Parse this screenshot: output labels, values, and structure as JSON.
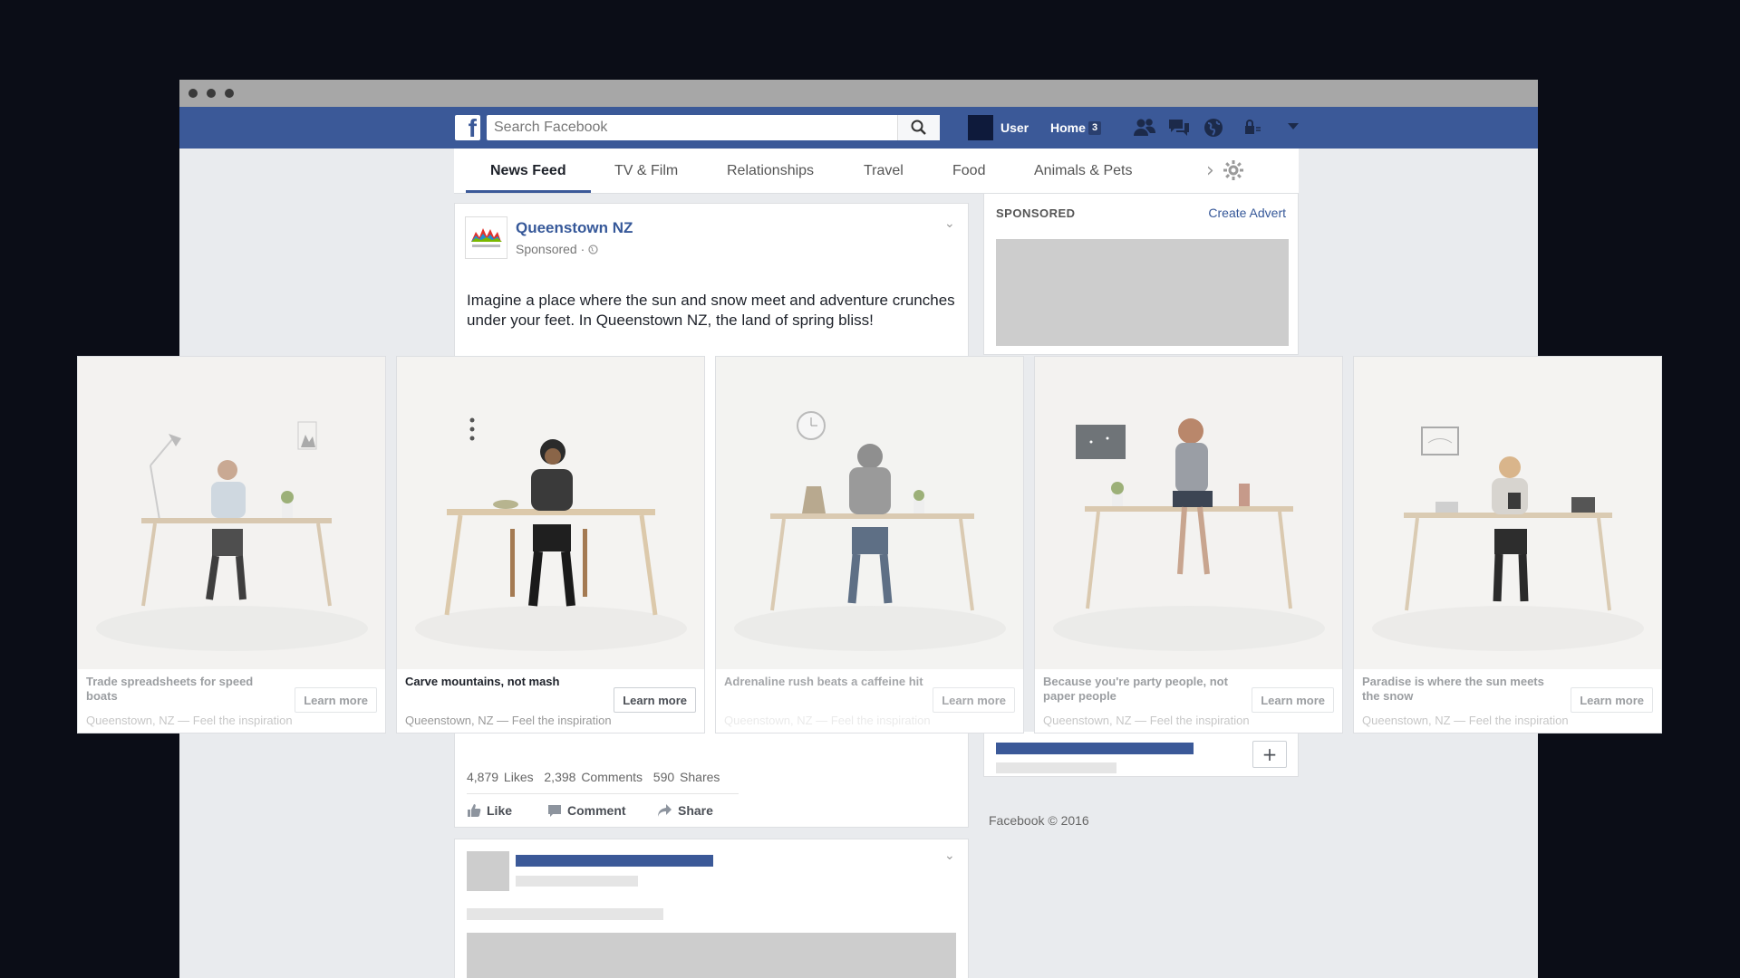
{
  "header": {
    "search_placeholder": "Search Facebook",
    "user_label": "User",
    "home_label": "Home",
    "home_badge": "3"
  },
  "tabs": [
    {
      "label": "News Feed",
      "active": true
    },
    {
      "label": "TV & Film"
    },
    {
      "label": "Relationships"
    },
    {
      "label": "Travel"
    },
    {
      "label": "Food"
    },
    {
      "label": "Animals & Pets"
    }
  ],
  "post": {
    "page_name": "Queenstown NZ",
    "sponsored": "Sponsored · ",
    "text": "Imagine a place where the sun and snow meet and adventure crunches under your feet. In Queenstown NZ, the land of spring bliss!",
    "stats": {
      "likes": "4,879 Likes",
      "comments": "2,398 Comments",
      "shares": "590 Shares"
    },
    "actions": {
      "like": "Like",
      "comment": "Comment",
      "share": "Share"
    }
  },
  "sidebar": {
    "sponsored_label": "SPONSORED",
    "create_advert": "Create Advert",
    "plus": "+",
    "footer": "Facebook © 2016"
  },
  "carousel": [
    {
      "caption": "Trade spreadsheets for speed boats",
      "button": "Learn more",
      "subtitle": "Queenstown, NZ — Feel the inspiration"
    },
    {
      "caption": "Carve mountains, not mash",
      "button": "Learn more",
      "subtitle": "Queenstown, NZ — Feel the inspiration"
    },
    {
      "caption": "Adrenaline rush beats a caffeine hit",
      "button": "Learn more",
      "subtitle": "Queenstown, NZ — Feel the inspiration"
    },
    {
      "caption": "Because you're party people, not paper people",
      "button": "Learn more",
      "subtitle": "Queenstown, NZ — Feel the inspiration"
    },
    {
      "caption": "Paradise is where the sun meets the snow",
      "button": "Learn more",
      "subtitle": "Queenstown, NZ — Feel the inspiration"
    }
  ],
  "colors": {
    "brand": "#3b5998",
    "link": "#365899",
    "page_bg": "#e9ebee"
  }
}
